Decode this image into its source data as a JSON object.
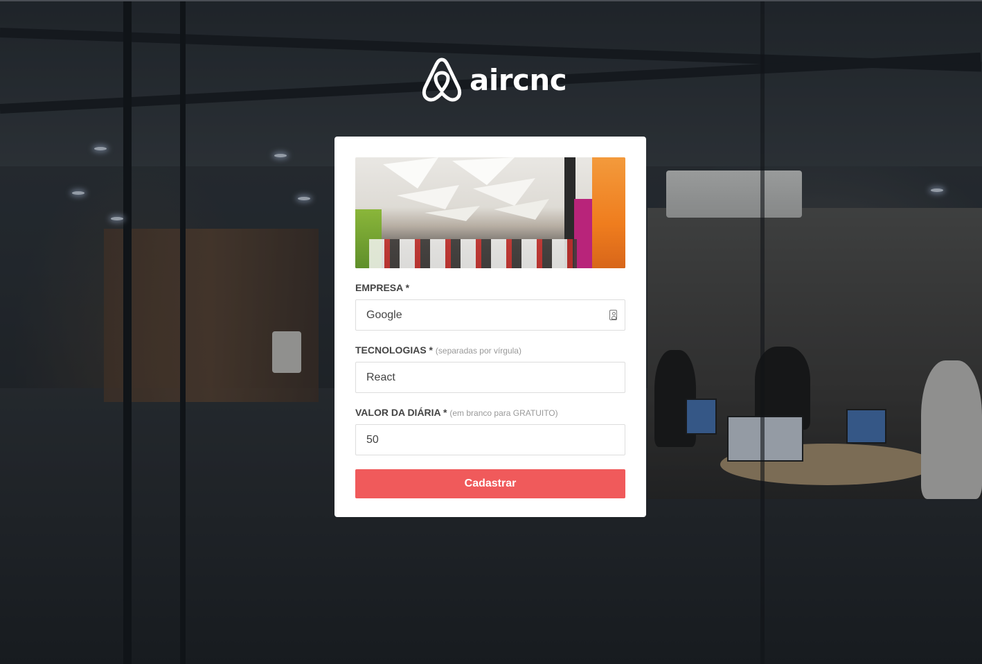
{
  "app": {
    "brand": "aircnc"
  },
  "colors": {
    "accent": "#f05a5b",
    "label": "#444444",
    "hint": "#999999",
    "card_bg": "#ffffff"
  },
  "icons": {
    "logo": "airbnb-belo-logo-icon",
    "field_contact": "contact-card-icon"
  },
  "form": {
    "thumbnail_alt": "thumbnail-preview",
    "company": {
      "label": "EMPRESA *",
      "value": "Google"
    },
    "techs": {
      "label": "TECNOLOGIAS *",
      "hint": "(separadas por vírgula)",
      "value": "React"
    },
    "price": {
      "label": "VALOR DA DIÁRIA *",
      "hint": "(em branco para GRATUITO)",
      "value": "50"
    },
    "submit_label": "Cadastrar"
  }
}
